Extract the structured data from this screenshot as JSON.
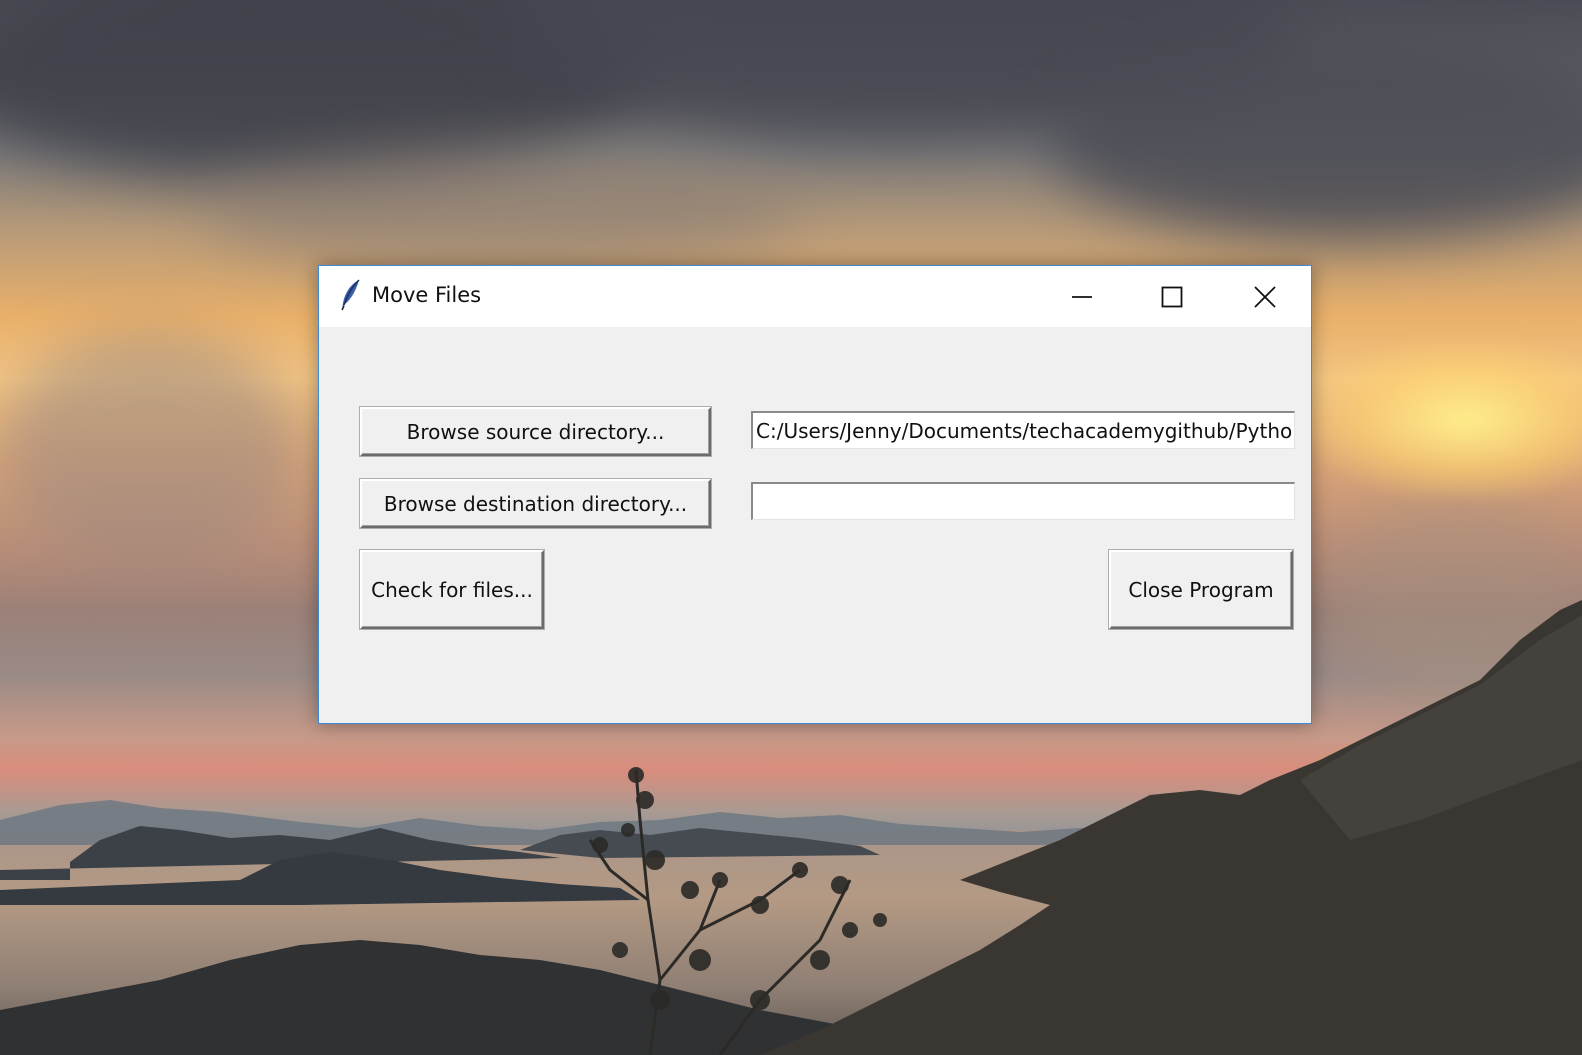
{
  "desktop": {
    "wallpaper": "sunset-landscape"
  },
  "window": {
    "title": "Move Files",
    "app_icon": "tk-feather-icon",
    "controls": {
      "minimize_icon": "minimize-icon",
      "maximize_icon": "maximize-icon",
      "close_icon": "close-icon"
    },
    "accent_border_color": "#3c8ad9",
    "background_color": "#f0f0f0"
  },
  "form": {
    "browse_source_label": "Browse source directory...",
    "browse_dest_label": "Browse destination directory...",
    "source_value": "C:/Users/Jenny/Documents/techacademygithub/Python-Projects",
    "dest_value": "",
    "check_files_label": "Check for files...",
    "close_program_label": "Close Program"
  }
}
